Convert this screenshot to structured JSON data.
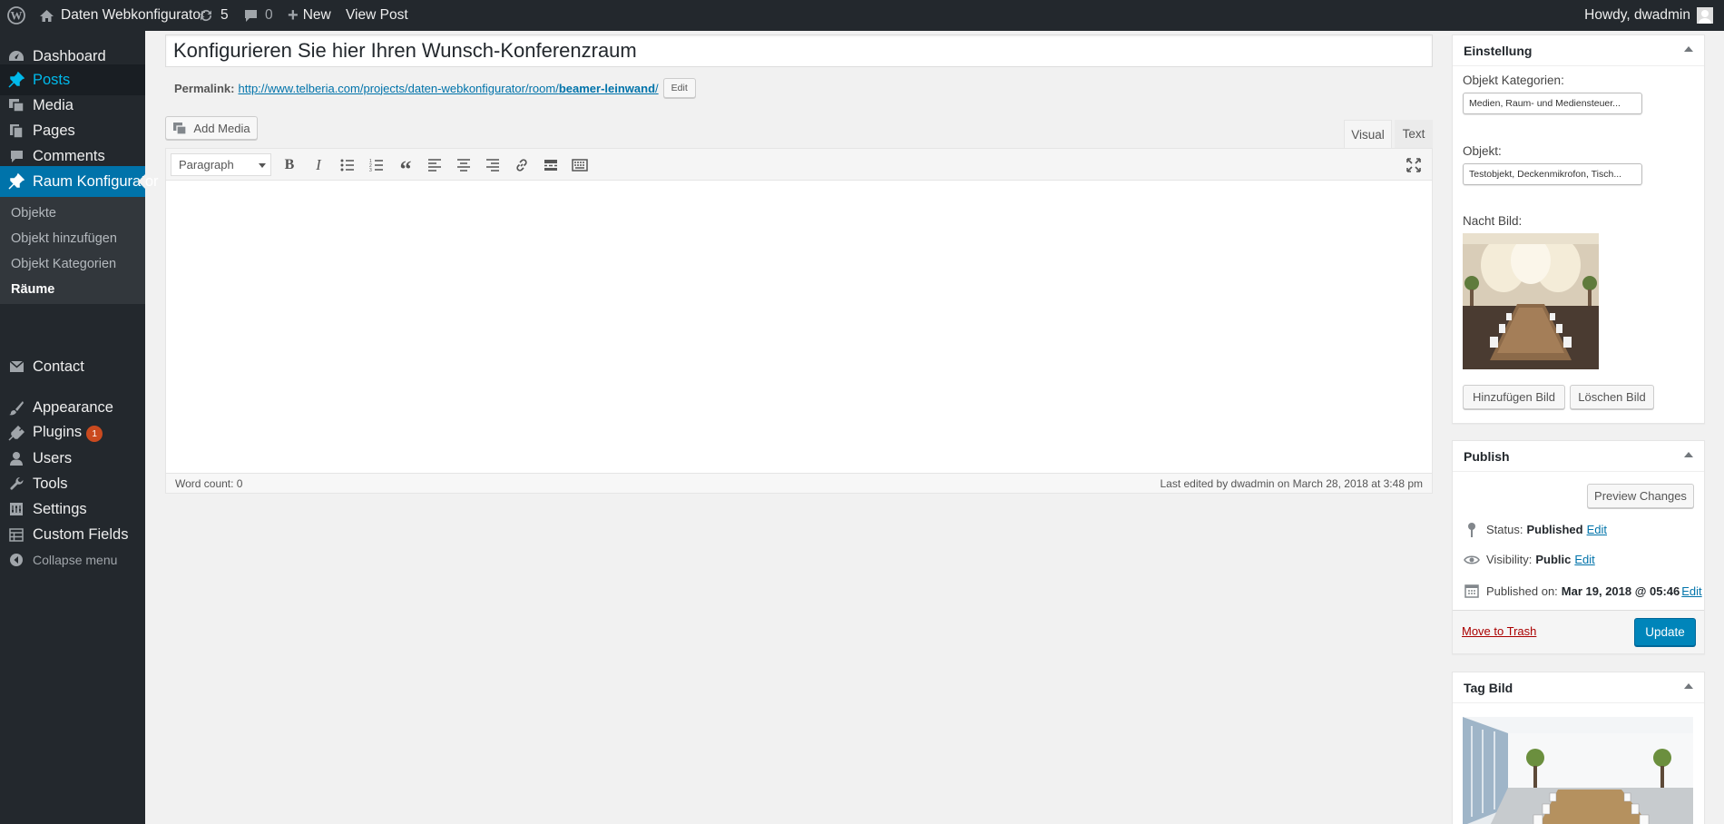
{
  "admin_bar": {
    "site_name": "Daten Webkonfigurator",
    "updates_count": "5",
    "comments_count": "0",
    "new_label": "New",
    "view_post_label": "View Post",
    "howdy": "Howdy, dwadmin"
  },
  "sidebar": {
    "items": [
      {
        "label": "Dashboard",
        "icon": "dashboard-icon"
      },
      {
        "label": "Posts",
        "icon": "pin-icon"
      },
      {
        "label": "Media",
        "icon": "media-icon"
      },
      {
        "label": "Pages",
        "icon": "pages-icon"
      },
      {
        "label": "Comments",
        "icon": "comment-icon"
      },
      {
        "label": "Raum Konfigurator",
        "icon": "pin-icon"
      },
      {
        "label": "Contact",
        "icon": "mail-icon"
      },
      {
        "label": "Appearance",
        "icon": "brush-icon"
      },
      {
        "label": "Plugins",
        "icon": "plugin-icon",
        "badge": "1"
      },
      {
        "label": "Users",
        "icon": "user-icon"
      },
      {
        "label": "Tools",
        "icon": "wrench-icon"
      },
      {
        "label": "Settings",
        "icon": "settings-icon"
      },
      {
        "label": "Custom Fields",
        "icon": "table-icon"
      }
    ],
    "submenu": [
      "Objekte",
      "Objekt hinzufügen",
      "Objekt Kategorien",
      "Räume"
    ],
    "collapse_label": "Collapse menu"
  },
  "editor": {
    "title": "Konfigurieren Sie hier Ihren Wunsch-Konferenzraum",
    "permalink_label": "Permalink:",
    "permalink_base": "http://www.telberia.com/projects/daten-webkonfigurator/room/",
    "permalink_slug": "beamer-leinwand",
    "permalink_end": "/",
    "edit_label": "Edit",
    "add_media_label": "Add Media",
    "tab_visual": "Visual",
    "tab_text": "Text",
    "format_select": "Paragraph",
    "word_count": "Word count: 0",
    "last_edited": "Last edited by dwadmin on March 28, 2018 at 3:48 pm"
  },
  "einstellung": {
    "title": "Einstellung",
    "kategorien_label": "Objekt Kategorien:",
    "kategorien_value": "Medien, Raum- und Mediensteuer...",
    "objekt_label": "Objekt:",
    "objekt_value": "Testobjekt, Deckenmikrofon, Tisch...",
    "nacht_label": "Nacht Bild:",
    "add_image_label": "Hinzufügen Bild",
    "delete_image_label": "Löschen Bild"
  },
  "publish": {
    "title": "Publish",
    "preview_label": "Preview Changes",
    "status_label": "Status:",
    "status_value": "Published",
    "visibility_label": "Visibility:",
    "visibility_value": "Public",
    "published_label": "Published on:",
    "published_value": "Mar 19, 2018 @ 05:46",
    "edit_label": "Edit",
    "trash_label": "Move to Trash",
    "update_label": "Update"
  },
  "tag_bild": {
    "title": "Tag Bild"
  },
  "colors": {
    "admin_dark": "#23282d",
    "accent_blue": "#0073aa",
    "posts_highlight": "#00b9eb",
    "badge_orange": "#ca4a1f",
    "update_button": "#0085ba"
  }
}
